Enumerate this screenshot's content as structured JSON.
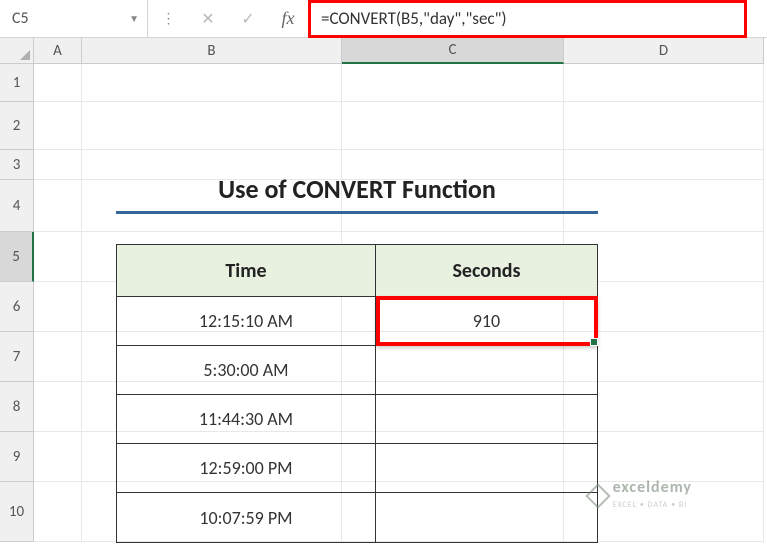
{
  "name_box": "C5",
  "formula": "=CONVERT(B5,\"day\",\"sec\")",
  "title": "Use of CONVERT Function",
  "columns": [
    "A",
    "B",
    "C",
    "D"
  ],
  "rows": [
    "1",
    "2",
    "3",
    "4",
    "5",
    "6",
    "7",
    "8",
    "9",
    "10"
  ],
  "active_col_index": 2,
  "active_row_index": 4,
  "table": {
    "headers": [
      "Time",
      "Seconds"
    ],
    "data": [
      {
        "time": "12:15:10 AM",
        "seconds": "910"
      },
      {
        "time": "5:30:00 AM",
        "seconds": ""
      },
      {
        "time": "11:44:30 AM",
        "seconds": ""
      },
      {
        "time": "12:59:00 PM",
        "seconds": ""
      },
      {
        "time": "10:07:59 PM",
        "seconds": ""
      }
    ]
  },
  "watermark": {
    "brand": "exceldemy",
    "tagline": "EXCEL • DATA • BI"
  }
}
